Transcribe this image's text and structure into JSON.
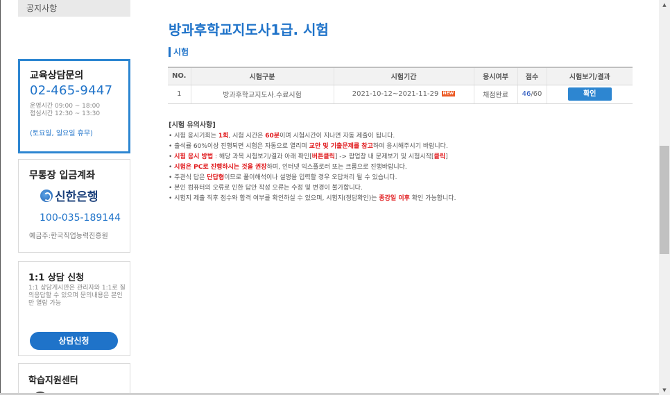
{
  "sidebar": {
    "notice_tab": "공지사항",
    "consult": {
      "title": "교육상담문의",
      "phone": "02-465-9447",
      "hours_line1": "운영시간 09:00 ~ 18:00",
      "hours_line2": "점심시간 12:30 ~ 13:30",
      "holiday": "(토요일, 일요일 휴무)"
    },
    "bank": {
      "title": "무통장 입금계좌",
      "bank_name": "신한은행",
      "account": "100-035-189144",
      "holder": "예금주:한국직업능력진흥원"
    },
    "qa": {
      "title": "1:1 상담 신청",
      "desc": "1:1 상담게시판은 관리자와 1:1로 질의응답할 수 있으며 문의내용은 본인만 열람 가능",
      "button": "상담신청"
    },
    "support": {
      "title": "학습지원센터"
    }
  },
  "main": {
    "page_title": "방과후학교지도사1급. 시험",
    "section_label": "시험",
    "table": {
      "headers": [
        "NO.",
        "시험구분",
        "시험기간",
        "응시여부",
        "점수",
        "시험보기/결과"
      ],
      "rows": [
        {
          "no": "1",
          "category": "방과후학교지도사.수료시험",
          "period": "2021-10-12~2021-11-29",
          "badge": "NEW",
          "status": "채점완료",
          "score": "46",
          "score_total": "/60",
          "action": "확인"
        }
      ]
    },
    "notes": {
      "title": "[시험 유의사항]",
      "n1_a": "• 시험 응시기회는 ",
      "n1_b": "1회",
      "n1_c": ", 시험 시간은 ",
      "n1_d": "60분",
      "n1_e": "이며 시험시간이 지나면 자동 제출이 됩니다.",
      "n2_a": "• 출석률 60%이상 진행되면 시험은 자동으로 열리며 ",
      "n2_b": "교안 및 기출문제를 참고",
      "n2_c": "하여 응시해주시기 바랍니다.",
      "n3_a": "• ",
      "n3_b": "시험 응시 방법",
      "n3_c": " : 해당 과목 시험보기/결과 아래 확인[",
      "n3_d": "버튼클릭",
      "n3_e": "] -> 팝업창 내 문제보기 및 시험시작[",
      "n3_f": "클릭",
      "n3_g": "]",
      "n4_a": "• ",
      "n4_b": "시험은 PC로 진행하시는 것을 권장",
      "n4_c": "하며, 인터넷 익스플로러 또는 크롬으로 진행바랍니다.",
      "n5_a": "• 주관식 답은 ",
      "n5_b": "단답형",
      "n5_c": "이므로 풀이해석이나 설명을 입력할 경우 오답처리 될 수 있습니다.",
      "n6": "• 본인 컴퓨터의 오류로 인한 답안 작성 오류는 수정 및 변경이 불가합니다.",
      "n7_a": "• 시험지 제출 직후 점수와 합격 여부를 확인하실 수 있으며, 시험지(정답확인)는 ",
      "n7_b": "종강일 이후",
      "n7_c": " 확인 가능합니다."
    }
  },
  "scrollbar": {
    "up_glyph": "▲",
    "down_glyph": "▼"
  },
  "colors": {
    "accent": "#1f73c9",
    "highlight_red": "#e0181b",
    "new_badge": "#ec5a24"
  }
}
